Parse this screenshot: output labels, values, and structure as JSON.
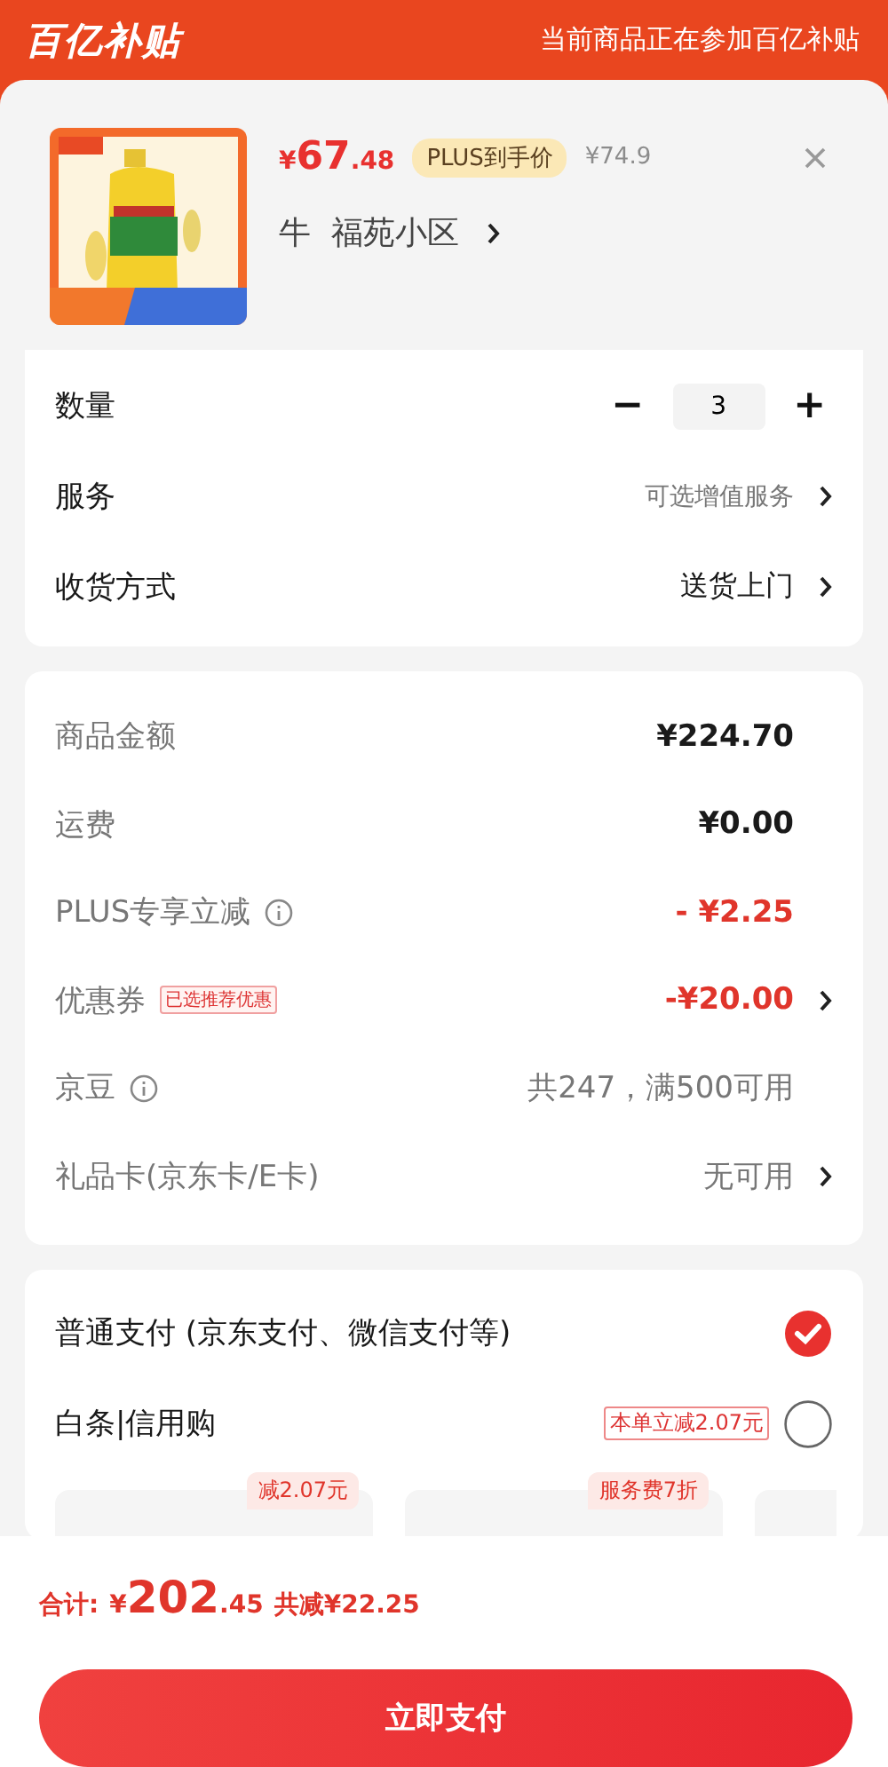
{
  "header": {
    "logo": "百亿补贴",
    "notice": "当前商品正在参加百亿补贴"
  },
  "product": {
    "price": "¥67.48",
    "badge": "PLUS到手价",
    "original_price": "¥74.9",
    "address": "牛  福苑小区"
  },
  "options": [
    {
      "kind": "stepper",
      "label": "数量",
      "value": "3",
      "minus": "−",
      "plus": "+"
    },
    {
      "kind": "link",
      "label": "服务",
      "value": "可选增值服务"
    },
    {
      "kind": "link",
      "label": "收货方式",
      "value": "送货上门"
    }
  ],
  "summary": [
    {
      "label": "商品金额",
      "value": "¥224.70",
      "color": "#1a1a1a",
      "info": false,
      "chevron": false
    },
    {
      "label": "运费",
      "value": "¥0.00",
      "color": "#1a1a1a",
      "info": false,
      "chevron": false
    },
    {
      "label": "PLUS专享立减",
      "value": "- ¥2.25",
      "color": "#e0352b",
      "info": true,
      "chevron": false
    },
    {
      "label": "优惠券",
      "tag": "已选推荐优惠",
      "value": "-¥20.00",
      "color": "#e0352b",
      "info": false,
      "chevron": true
    },
    {
      "label": "京豆",
      "value": "共247，满500可用",
      "color": "#777777",
      "info": true,
      "chevron": false
    },
    {
      "label": "礼品卡(京东卡/E卡)",
      "value": "无可用",
      "color": "#777777",
      "info": false,
      "chevron": true
    }
  ],
  "payment": {
    "methods": [
      {
        "label": "普通支付 (京东支付、微信支付等)",
        "selected": true
      },
      {
        "label": "白条|信用购",
        "tag": "本单立减2.07元",
        "selected": false
      }
    ],
    "plans": [
      {
        "kind": "plan",
        "badge": "减2.07元"
      },
      {
        "kind": "plan",
        "badge": "服务费7折"
      },
      {
        "kind": "plan"
      }
    ]
  },
  "footer": {
    "total_label": "合计:",
    "total": "¥202.45",
    "savings": "共减¥22.25",
    "button": "立即支付"
  }
}
